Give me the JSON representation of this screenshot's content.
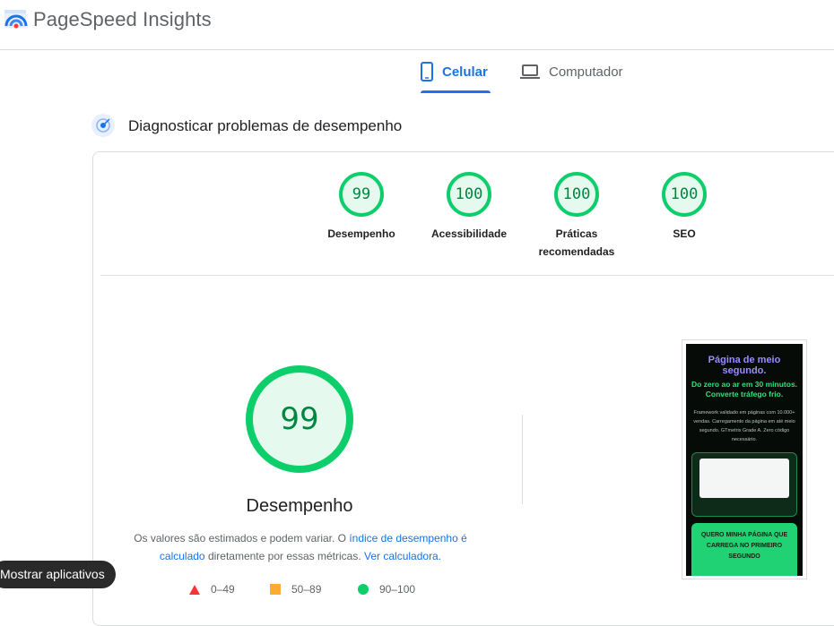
{
  "header": {
    "title": "PageSpeed Insights"
  },
  "tabs": [
    {
      "label": "Celular",
      "active": true
    },
    {
      "label": "Computador",
      "active": false
    }
  ],
  "section": {
    "title": "Diagnosticar problemas de desempenho"
  },
  "scores": [
    {
      "value": "99",
      "label": "Desempenho"
    },
    {
      "value": "100",
      "label": "Acessibilidade"
    },
    {
      "value": "100",
      "label_line1": "Práticas",
      "label_line2": "recomendadas"
    },
    {
      "value": "100",
      "label": "SEO"
    }
  ],
  "main_score": {
    "value": "99",
    "label": "Desempenho",
    "desc_part1": "Os valores são estimados e podem variar. O ",
    "desc_link1": "índice de desempenho é calculado",
    "desc_part2": " diretamente por essas métricas. ",
    "desc_link2": "Ver calculadora."
  },
  "legend": [
    {
      "range": "0–49",
      "color": "#ff3333",
      "shape": "triangle"
    },
    {
      "range": "50–89",
      "color": "#ffaa33",
      "shape": "square"
    },
    {
      "range": "90–100",
      "color": "#0cce6b",
      "shape": "circle"
    }
  ],
  "thumbnail": {
    "headline": "Página de meio segundo.",
    "subheadline": "Do zero ao ar em 30 minutos. Converte tráfego frio.",
    "body": "Framework validado em páginas com 10.000+ vendas. Carregamento da página em até meio segundo. GTmetrix Grade A. Zero código necessário.",
    "cta": "QUERO MINHA PÁGINA QUE CARREGA NO PRIMEIRO SEGUNDO"
  },
  "tooltip": {
    "text": "Mostrar aplicativos"
  },
  "colors": {
    "accent": "#1a73e8",
    "pass": "#0cce6b",
    "pass_text": "#018642"
  }
}
